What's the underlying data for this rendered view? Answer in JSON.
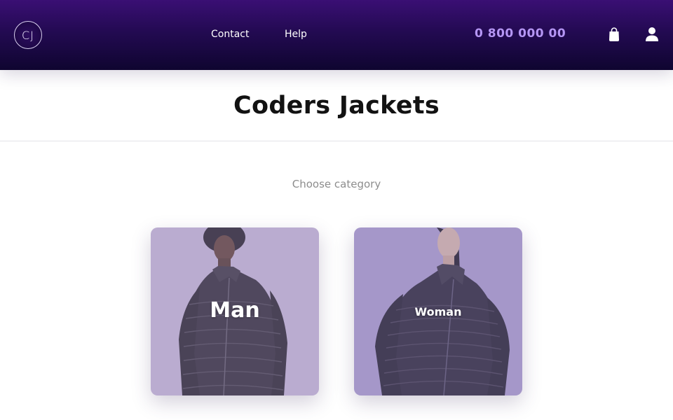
{
  "header": {
    "logo_text": "CJ",
    "nav": {
      "contact": "Contact",
      "help": "Help"
    },
    "phone": "0 800 000 00",
    "icons": {
      "cart": "shopping-bag-icon",
      "user": "user-icon"
    },
    "colors": {
      "gradient_top": "#3a0f74",
      "gradient_bottom": "#0f0530",
      "phone": "#b596f4"
    }
  },
  "page": {
    "title": "Coders Jackets",
    "subtitle": "Choose category"
  },
  "categories": [
    {
      "label": "Man",
      "tint": "#bdafd0"
    },
    {
      "label": "Woman",
      "tint": "#a99bcb"
    }
  ]
}
